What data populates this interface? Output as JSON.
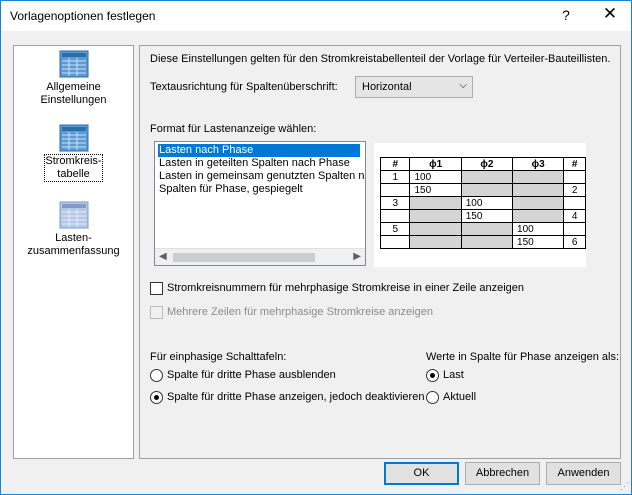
{
  "window": {
    "title": "Vorlagenoptionen festlegen",
    "help": "?",
    "close": "✕"
  },
  "sidebar": {
    "items": [
      {
        "label": "Allgemeine Einstellungen",
        "icon": "table-icon",
        "selected": false
      },
      {
        "label": "Stromkreis-tabelle",
        "icon": "table-icon",
        "selected": true
      },
      {
        "label": "Lasten-zusammenfassung",
        "icon": "table-icon",
        "selected": false
      }
    ],
    "labels": {
      "item0_line1": "Allgemeine",
      "item0_line2": "Einstellungen",
      "item1_line1": "Stromkreis-",
      "item1_line2": "tabelle",
      "item2_line1": "Lasten-",
      "item2_line2": "zusammenfassung"
    }
  },
  "main": {
    "intro": "Diese Einstellungen gelten für den Stromkreistabellenteil der Vorlage für Verteiler-Bauteillisten.",
    "text_direction_label": "Textausrichtung für Spaltenüberschrift:",
    "text_direction_value": "Horizontal",
    "format_label": "Format für Lastenanzeige wählen:",
    "format_options": [
      "Lasten nach Phase",
      "Lasten in geteilten Spalten nach Phase",
      "Lasten in gemeinsam genutzten Spalten na",
      "Spalten für Phase, gespiegelt"
    ],
    "preview": {
      "headers": [
        "#",
        "ϕ1",
        "ϕ2",
        "ϕ3",
        "#"
      ],
      "rows": [
        [
          "1",
          "100",
          "",
          "",
          ""
        ],
        [
          "",
          "150",
          "",
          "",
          "2"
        ],
        [
          "3",
          "",
          "100",
          "",
          ""
        ],
        [
          "",
          "",
          "150",
          "",
          "4"
        ],
        [
          "5",
          "",
          "",
          "100",
          ""
        ],
        [
          "",
          "",
          "",
          "150",
          "6"
        ]
      ]
    },
    "checkbox_multiphase_row": "Stromkreisnummern für mehrphasige Stromkreise in einer Zeile anzeigen",
    "checkbox_multirow": "Mehrere Zeilen für mehrphasige Stromkreise anzeigen",
    "singlephase_label": "Für einphasige Schalttafeln:",
    "radio_hide": "Spalte für dritte Phase ausblenden",
    "radio_show_disabled": "Spalte für dritte Phase anzeigen, jedoch deaktivieren",
    "values_label": "Werte in Spalte für Phase anzeigen als:",
    "radio_load": "Last",
    "radio_current": "Aktuell"
  },
  "footer": {
    "ok": "OK",
    "cancel": "Abbrechen",
    "apply": "Anwenden"
  },
  "colors": {
    "accent": "#0078d7",
    "border": "#1883d7"
  }
}
